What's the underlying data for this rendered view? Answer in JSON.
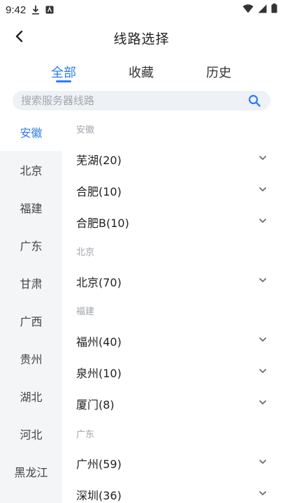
{
  "status": {
    "time": "9:42"
  },
  "header": {
    "title": "线路选择"
  },
  "tabs": [
    {
      "label": "全部"
    },
    {
      "label": "收藏"
    },
    {
      "label": "历史"
    }
  ],
  "search": {
    "placeholder": "搜索服务器线路"
  },
  "sidebar": {
    "items": [
      {
        "label": "安徽"
      },
      {
        "label": "北京"
      },
      {
        "label": "福建"
      },
      {
        "label": "广东"
      },
      {
        "label": "甘肃"
      },
      {
        "label": "广西"
      },
      {
        "label": "贵州"
      },
      {
        "label": "湖北"
      },
      {
        "label": "河北"
      },
      {
        "label": "黑龙江"
      }
    ]
  },
  "list": {
    "groups": [
      {
        "label": "安徽",
        "rows": [
          {
            "label": "芜湖(20)"
          },
          {
            "label": "合肥(10)"
          },
          {
            "label": "合肥B(10)"
          }
        ]
      },
      {
        "label": "北京",
        "rows": [
          {
            "label": "北京(70)"
          }
        ]
      },
      {
        "label": "福建",
        "rows": [
          {
            "label": "福州(40)"
          },
          {
            "label": "泉州(10)"
          },
          {
            "label": "厦门(8)"
          }
        ]
      },
      {
        "label": "广东",
        "rows": [
          {
            "label": "广州(59)"
          },
          {
            "label": "深圳(36)"
          }
        ]
      }
    ]
  },
  "colors": {
    "accent": "#2b7cf6",
    "sidebar_bg": "#f4f5f7",
    "search_bg": "#eef1f5"
  }
}
